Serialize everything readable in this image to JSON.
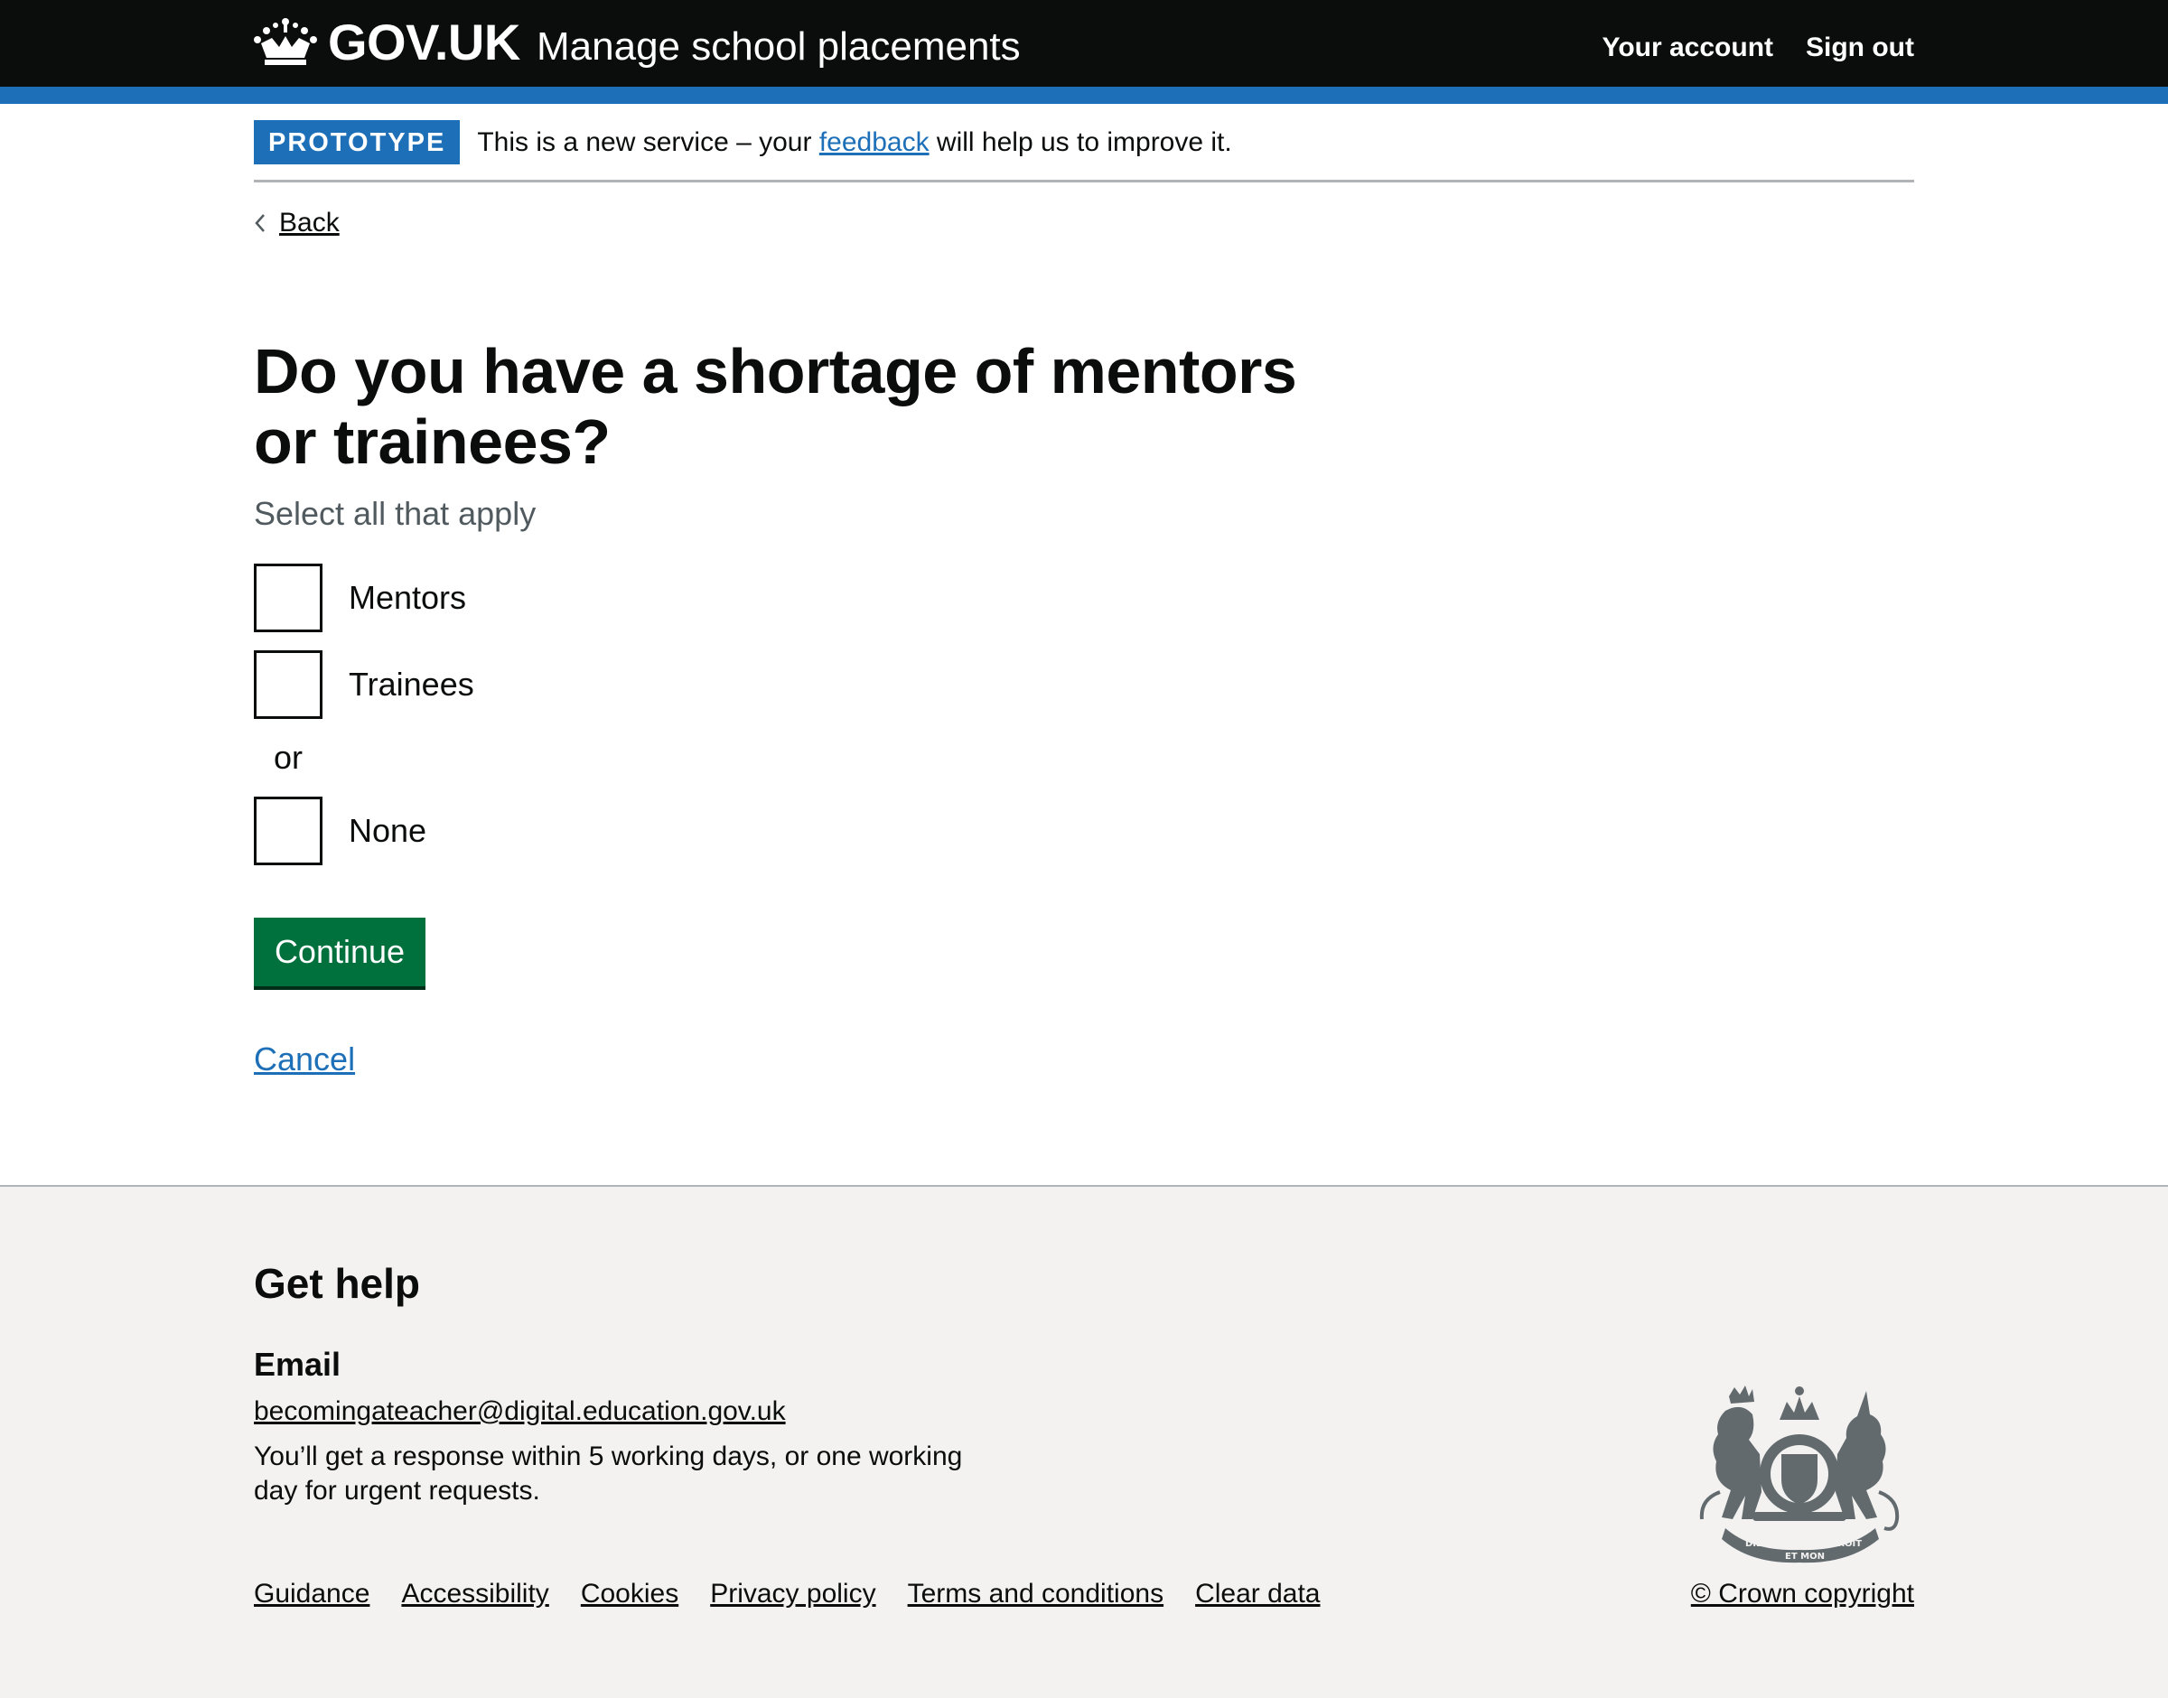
{
  "header": {
    "logo_text": "GOV.UK",
    "service_name": "Manage school placements",
    "nav": [
      "Your account",
      "Sign out"
    ]
  },
  "phase_banner": {
    "tag": "PROTOTYPE",
    "text_before": "This is a new service – your ",
    "link_text": "feedback",
    "text_after": " will help us to improve it."
  },
  "back_link": "Back",
  "main": {
    "title": "Do you have a shortage of mentors or trainees?",
    "hint": "Select all that apply",
    "options": [
      {
        "label": "Mentors",
        "checked": false
      },
      {
        "label": "Trainees",
        "checked": false
      },
      {
        "label": "None",
        "checked": false
      }
    ],
    "divider": "or",
    "continue_label": "Continue",
    "cancel_label": "Cancel"
  },
  "footer": {
    "heading": "Get help",
    "email_heading": "Email",
    "email": "becomingateacher@digital.education.gov.uk",
    "response_text": "You’ll get a response within 5 working days, or one working day for urgent requests.",
    "links": [
      "Guidance",
      "Accessibility",
      "Cookies",
      "Privacy policy",
      "Terms and conditions",
      "Clear data"
    ],
    "copyright": "© Crown copyright",
    "crest_motto": [
      "DIEU",
      "ET MON",
      "DROIT"
    ]
  },
  "colors": {
    "header_bg": "#0b0c0c",
    "brand_blue": "#1d70b8",
    "button_green": "#00703c",
    "footer_bg": "#f3f2f1",
    "hint_grey": "#505a5f"
  }
}
